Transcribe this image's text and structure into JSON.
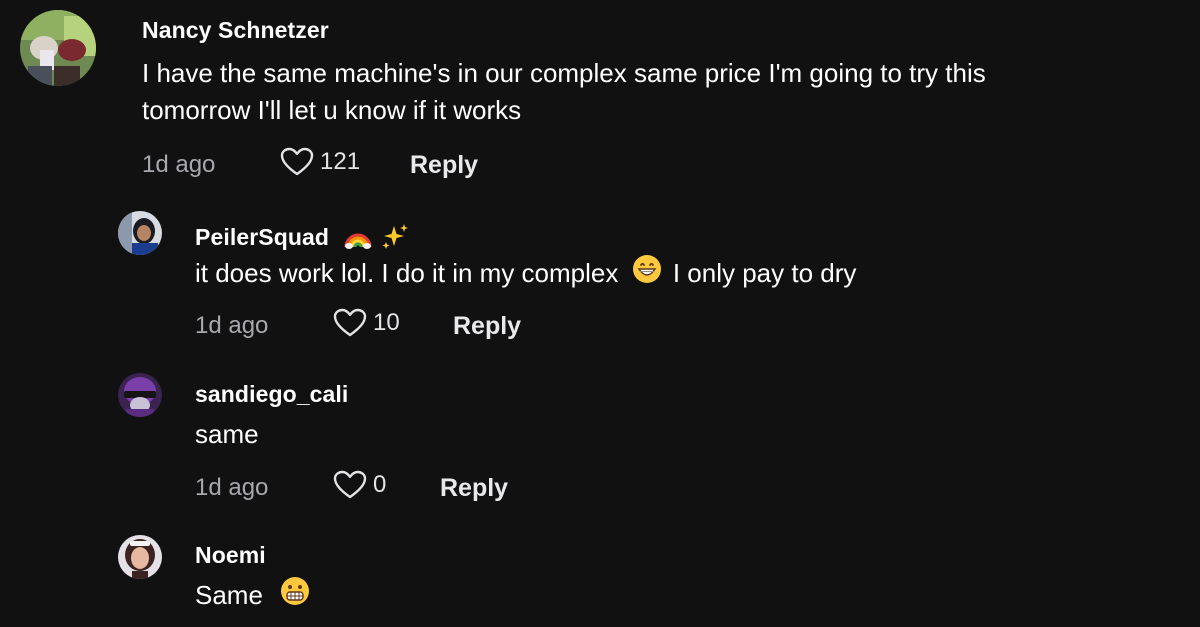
{
  "comments": [
    {
      "username": "Nancy Schnetzer",
      "text_line1": "I have the same machine's in our complex same price I'm going to try this",
      "text_line2": "tomorrow I'll let u know if it works",
      "time": "1d ago",
      "likes": "121",
      "reply_label": "Reply",
      "avatar_icon": "photo-avatar-icon"
    },
    {
      "username": "PeilerSquad",
      "username_emojis": [
        "rainbow-icon",
        "sparkles-icon"
      ],
      "text_before_emoji": "it does work lol. I do it in my complex",
      "text_after_emoji": "I only pay to dry",
      "inline_emoji": "grinning-face-icon",
      "time": "1d ago",
      "likes": "10",
      "reply_label": "Reply",
      "avatar_icon": "photo-avatar-icon"
    },
    {
      "username": "sandiego_cali",
      "text": "same",
      "time": "1d ago",
      "likes": "0",
      "reply_label": "Reply",
      "avatar_icon": "photo-avatar-icon"
    },
    {
      "username": "Noemi",
      "text": "Same",
      "inline_emoji": "grimacing-face-icon",
      "avatar_icon": "photo-avatar-icon"
    }
  ],
  "colors": {
    "background": "#111112",
    "text_primary": "#ffffff",
    "text_secondary": "#a7a7ad"
  }
}
